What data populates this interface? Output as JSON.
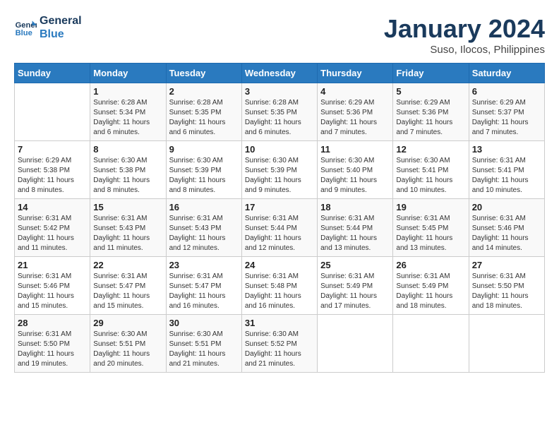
{
  "header": {
    "logo_line1": "General",
    "logo_line2": "Blue",
    "title": "January 2024",
    "subtitle": "Suso, Ilocos, Philippines"
  },
  "days_of_week": [
    "Sunday",
    "Monday",
    "Tuesday",
    "Wednesday",
    "Thursday",
    "Friday",
    "Saturday"
  ],
  "weeks": [
    [
      {
        "num": "",
        "info": ""
      },
      {
        "num": "1",
        "info": "Sunrise: 6:28 AM\nSunset: 5:34 PM\nDaylight: 11 hours\nand 6 minutes."
      },
      {
        "num": "2",
        "info": "Sunrise: 6:28 AM\nSunset: 5:35 PM\nDaylight: 11 hours\nand 6 minutes."
      },
      {
        "num": "3",
        "info": "Sunrise: 6:28 AM\nSunset: 5:35 PM\nDaylight: 11 hours\nand 6 minutes."
      },
      {
        "num": "4",
        "info": "Sunrise: 6:29 AM\nSunset: 5:36 PM\nDaylight: 11 hours\nand 7 minutes."
      },
      {
        "num": "5",
        "info": "Sunrise: 6:29 AM\nSunset: 5:36 PM\nDaylight: 11 hours\nand 7 minutes."
      },
      {
        "num": "6",
        "info": "Sunrise: 6:29 AM\nSunset: 5:37 PM\nDaylight: 11 hours\nand 7 minutes."
      }
    ],
    [
      {
        "num": "7",
        "info": "Sunrise: 6:29 AM\nSunset: 5:38 PM\nDaylight: 11 hours\nand 8 minutes."
      },
      {
        "num": "8",
        "info": "Sunrise: 6:30 AM\nSunset: 5:38 PM\nDaylight: 11 hours\nand 8 minutes."
      },
      {
        "num": "9",
        "info": "Sunrise: 6:30 AM\nSunset: 5:39 PM\nDaylight: 11 hours\nand 8 minutes."
      },
      {
        "num": "10",
        "info": "Sunrise: 6:30 AM\nSunset: 5:39 PM\nDaylight: 11 hours\nand 9 minutes."
      },
      {
        "num": "11",
        "info": "Sunrise: 6:30 AM\nSunset: 5:40 PM\nDaylight: 11 hours\nand 9 minutes."
      },
      {
        "num": "12",
        "info": "Sunrise: 6:30 AM\nSunset: 5:41 PM\nDaylight: 11 hours\nand 10 minutes."
      },
      {
        "num": "13",
        "info": "Sunrise: 6:31 AM\nSunset: 5:41 PM\nDaylight: 11 hours\nand 10 minutes."
      }
    ],
    [
      {
        "num": "14",
        "info": "Sunrise: 6:31 AM\nSunset: 5:42 PM\nDaylight: 11 hours\nand 11 minutes."
      },
      {
        "num": "15",
        "info": "Sunrise: 6:31 AM\nSunset: 5:43 PM\nDaylight: 11 hours\nand 11 minutes."
      },
      {
        "num": "16",
        "info": "Sunrise: 6:31 AM\nSunset: 5:43 PM\nDaylight: 11 hours\nand 12 minutes."
      },
      {
        "num": "17",
        "info": "Sunrise: 6:31 AM\nSunset: 5:44 PM\nDaylight: 11 hours\nand 12 minutes."
      },
      {
        "num": "18",
        "info": "Sunrise: 6:31 AM\nSunset: 5:44 PM\nDaylight: 11 hours\nand 13 minutes."
      },
      {
        "num": "19",
        "info": "Sunrise: 6:31 AM\nSunset: 5:45 PM\nDaylight: 11 hours\nand 13 minutes."
      },
      {
        "num": "20",
        "info": "Sunrise: 6:31 AM\nSunset: 5:46 PM\nDaylight: 11 hours\nand 14 minutes."
      }
    ],
    [
      {
        "num": "21",
        "info": "Sunrise: 6:31 AM\nSunset: 5:46 PM\nDaylight: 11 hours\nand 15 minutes."
      },
      {
        "num": "22",
        "info": "Sunrise: 6:31 AM\nSunset: 5:47 PM\nDaylight: 11 hours\nand 15 minutes."
      },
      {
        "num": "23",
        "info": "Sunrise: 6:31 AM\nSunset: 5:47 PM\nDaylight: 11 hours\nand 16 minutes."
      },
      {
        "num": "24",
        "info": "Sunrise: 6:31 AM\nSunset: 5:48 PM\nDaylight: 11 hours\nand 16 minutes."
      },
      {
        "num": "25",
        "info": "Sunrise: 6:31 AM\nSunset: 5:49 PM\nDaylight: 11 hours\nand 17 minutes."
      },
      {
        "num": "26",
        "info": "Sunrise: 6:31 AM\nSunset: 5:49 PM\nDaylight: 11 hours\nand 18 minutes."
      },
      {
        "num": "27",
        "info": "Sunrise: 6:31 AM\nSunset: 5:50 PM\nDaylight: 11 hours\nand 18 minutes."
      }
    ],
    [
      {
        "num": "28",
        "info": "Sunrise: 6:31 AM\nSunset: 5:50 PM\nDaylight: 11 hours\nand 19 minutes."
      },
      {
        "num": "29",
        "info": "Sunrise: 6:30 AM\nSunset: 5:51 PM\nDaylight: 11 hours\nand 20 minutes."
      },
      {
        "num": "30",
        "info": "Sunrise: 6:30 AM\nSunset: 5:51 PM\nDaylight: 11 hours\nand 21 minutes."
      },
      {
        "num": "31",
        "info": "Sunrise: 6:30 AM\nSunset: 5:52 PM\nDaylight: 11 hours\nand 21 minutes."
      },
      {
        "num": "",
        "info": ""
      },
      {
        "num": "",
        "info": ""
      },
      {
        "num": "",
        "info": ""
      }
    ]
  ]
}
